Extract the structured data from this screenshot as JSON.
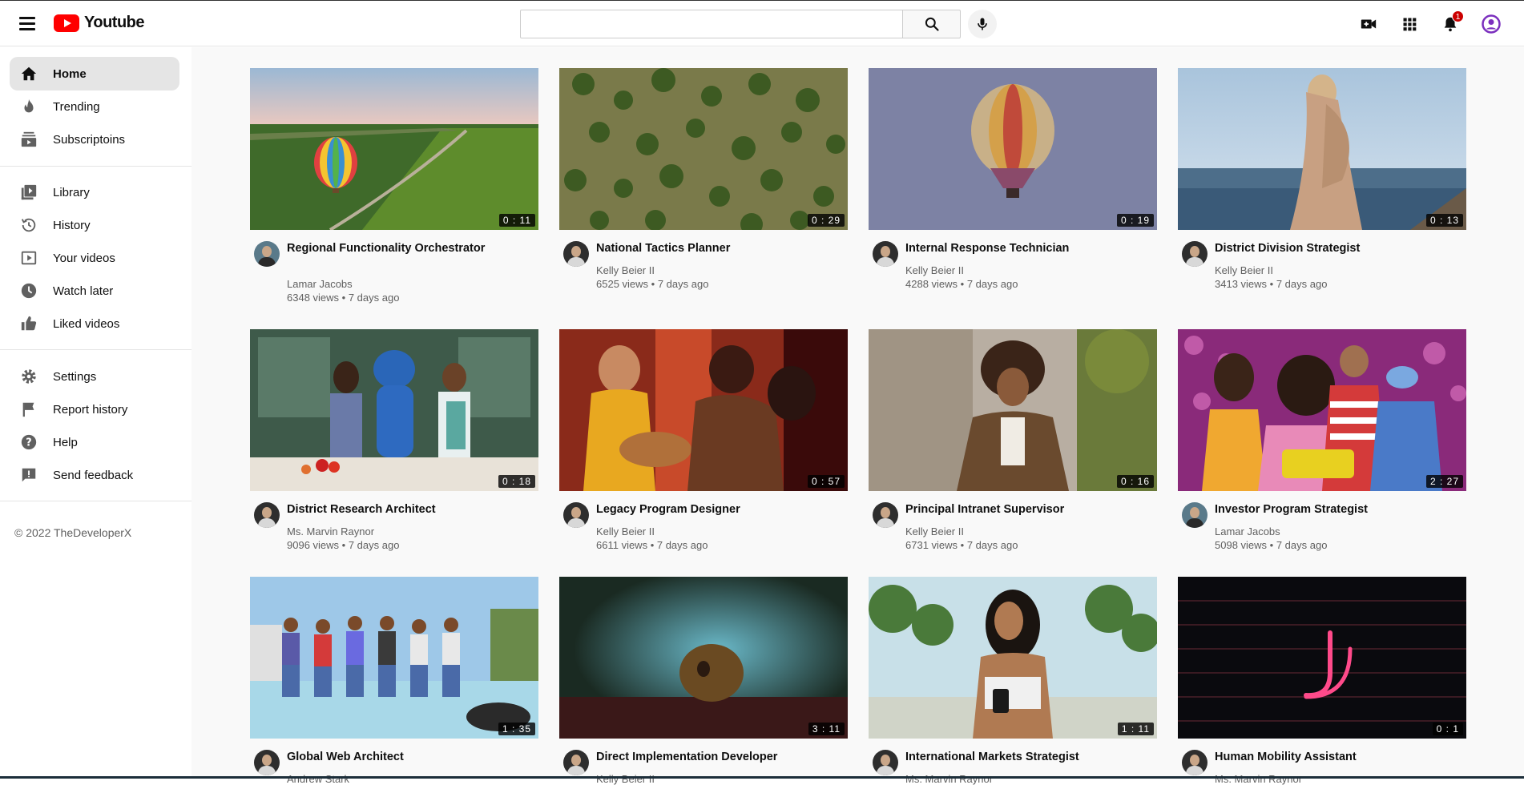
{
  "header": {
    "brand": "Youtube",
    "search_placeholder": "",
    "notification_count": "1"
  },
  "sidebar": {
    "items": [
      {
        "label": "Home",
        "icon": "home-icon"
      },
      {
        "label": "Trending",
        "icon": "trending-icon"
      },
      {
        "label": "Subscriptoins",
        "icon": "subscriptions-icon"
      },
      {
        "label": "Library",
        "icon": "library-icon"
      },
      {
        "label": "History",
        "icon": "history-icon"
      },
      {
        "label": "Your videos",
        "icon": "your-videos-icon"
      },
      {
        "label": "Watch later",
        "icon": "watch-later-icon"
      },
      {
        "label": "Liked videos",
        "icon": "like-icon"
      },
      {
        "label": "Settings",
        "icon": "gear-icon"
      },
      {
        "label": "Report history",
        "icon": "flag-icon"
      },
      {
        "label": "Help",
        "icon": "help-icon"
      },
      {
        "label": "Send feedback",
        "icon": "feedback-icon"
      }
    ],
    "copyright": "© 2022 TheDeveloperX"
  },
  "videos": [
    {
      "title": "Regional Functionality Orchestrator",
      "channel": "Lamar Jacobs",
      "views": "6348 views",
      "age": "7 days ago",
      "duration": "0 : 11"
    },
    {
      "title": "National Tactics Planner",
      "channel": "Kelly Beier II",
      "views": "6525 views",
      "age": "7 days ago",
      "duration": "0 : 29"
    },
    {
      "title": "Internal Response Technician",
      "channel": "Kelly Beier II",
      "views": "4288 views",
      "age": "7 days ago",
      "duration": "0 : 19"
    },
    {
      "title": "District Division Strategist",
      "channel": "Kelly Beier II",
      "views": "3413 views",
      "age": "7 days ago",
      "duration": "0 : 13"
    },
    {
      "title": "District Research Architect",
      "channel": "Ms. Marvin Raynor",
      "views": "9096 views",
      "age": "7 days ago",
      "duration": "0 : 18"
    },
    {
      "title": "Legacy Program Designer",
      "channel": "Kelly Beier II",
      "views": "6611 views",
      "age": "7 days ago",
      "duration": "0 : 57"
    },
    {
      "title": "Principal Intranet Supervisor",
      "channel": "Kelly Beier II",
      "views": "6731 views",
      "age": "7 days ago",
      "duration": "0 : 16"
    },
    {
      "title": "Investor Program Strategist",
      "channel": "Lamar Jacobs",
      "views": "5098 views",
      "age": "7 days ago",
      "duration": "2 : 27"
    },
    {
      "title": "Global Web Architect",
      "channel": "Andrew Stark",
      "views": "",
      "age": "",
      "duration": "1 : 35"
    },
    {
      "title": "Direct Implementation Developer",
      "channel": "Kelly Beier II",
      "views": "",
      "age": "",
      "duration": "3 : 11"
    },
    {
      "title": "International Markets Strategist",
      "channel": "Ms. Marvin Raynor",
      "views": "",
      "age": "",
      "duration": "1 : 11"
    },
    {
      "title": "Human Mobility Assistant",
      "channel": "Ms. Marvin Raynor",
      "views": "",
      "age": "",
      "duration": "0 : 1"
    }
  ],
  "colors": {
    "brand_red": "#ff0000",
    "avatar_purple": "#7b2fbe"
  }
}
